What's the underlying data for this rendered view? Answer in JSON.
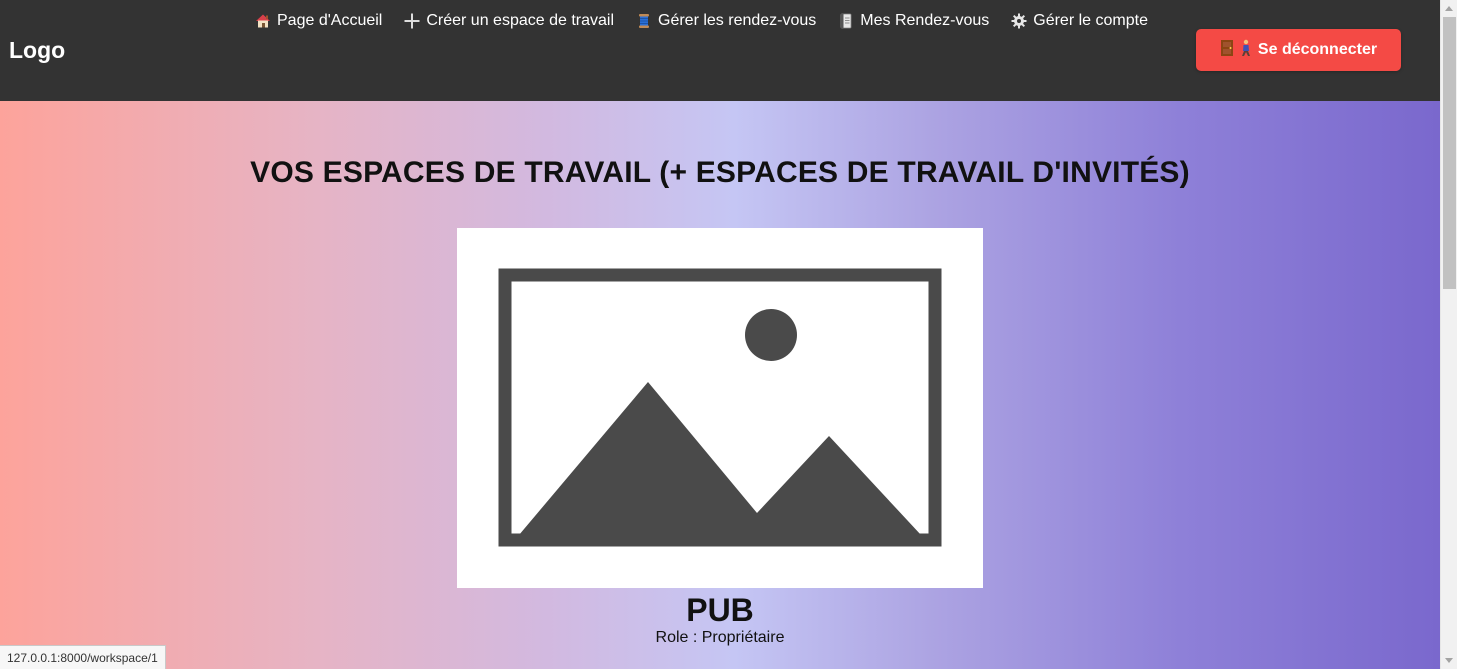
{
  "header": {
    "logo": "Logo",
    "nav": [
      {
        "label": "Page d'Accueil",
        "icon": "home-icon"
      },
      {
        "label": "Créer un espace de travail",
        "icon": "plus-icon"
      },
      {
        "label": "Gérer les rendez-vous",
        "icon": "spool-icon"
      },
      {
        "label": "Mes Rendez-vous",
        "icon": "notebook-icon"
      },
      {
        "label": "Gérer le compte",
        "icon": "gear-icon"
      }
    ],
    "logout_label": "Se déconnecter",
    "logout_icons": [
      "door-icon",
      "person-walking-icon"
    ]
  },
  "main": {
    "title": "VOS ESPACES DE TRAVAIL (+ ESPACES DE TRAVAIL D'INVITÉS)",
    "workspaces": [
      {
        "name": "PUB",
        "role": "Role : Propriétaire",
        "image": "image-placeholder-icon"
      }
    ]
  },
  "status_bar": {
    "url": "127.0.0.1:8000/workspace/1"
  },
  "colors": {
    "header_bg": "#333333",
    "logout_bg": "#f44a45",
    "gradient": [
      "#fda39b",
      "#c5c6f4",
      "#7a68cd"
    ]
  }
}
